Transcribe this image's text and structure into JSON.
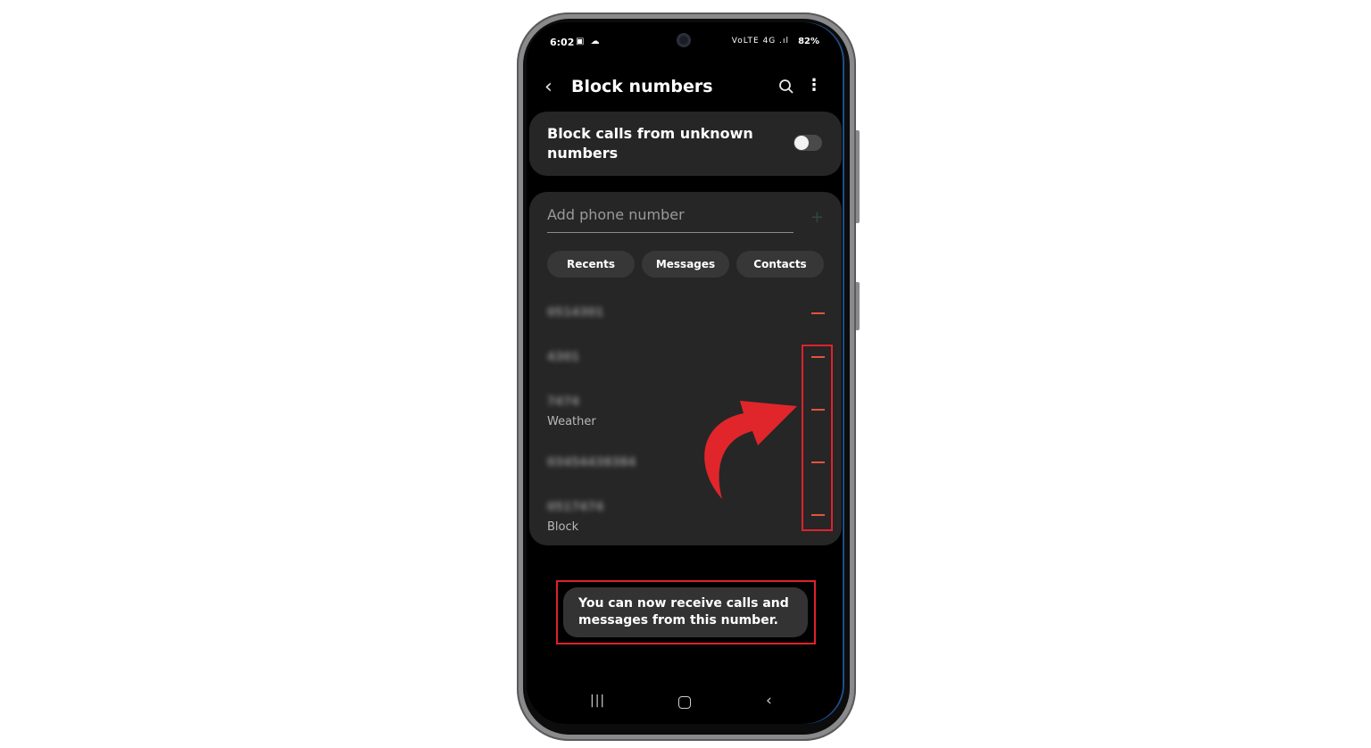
{
  "status_bar": {
    "time": "6:02",
    "left_icons": "▣ ☁",
    "signal": "VoLTE 4G .ıl",
    "battery": "82%"
  },
  "app_bar": {
    "title": "Block numbers",
    "back_icon": "back-icon",
    "search_icon": "search-icon",
    "more_icon": "more-options-icon"
  },
  "block_unknown": {
    "label": "Block calls from unknown numbers",
    "enabled": false
  },
  "add_number": {
    "placeholder": "Add phone number"
  },
  "sources": [
    "Recents",
    "Messages",
    "Contacts"
  ],
  "blocked_list": [
    {
      "number": "0514301",
      "sublabel": ""
    },
    {
      "number": "4301",
      "sublabel": ""
    },
    {
      "number": "7474",
      "sublabel": "Weather"
    },
    {
      "number": "03454438384",
      "sublabel": ""
    },
    {
      "number": "0517474",
      "sublabel": "Block"
    }
  ],
  "toast": {
    "message": "You can now receive calls and messages from this number."
  },
  "colors": {
    "accent_remove": "#e2543c",
    "highlight": "#e0212d",
    "card": "#262626"
  }
}
